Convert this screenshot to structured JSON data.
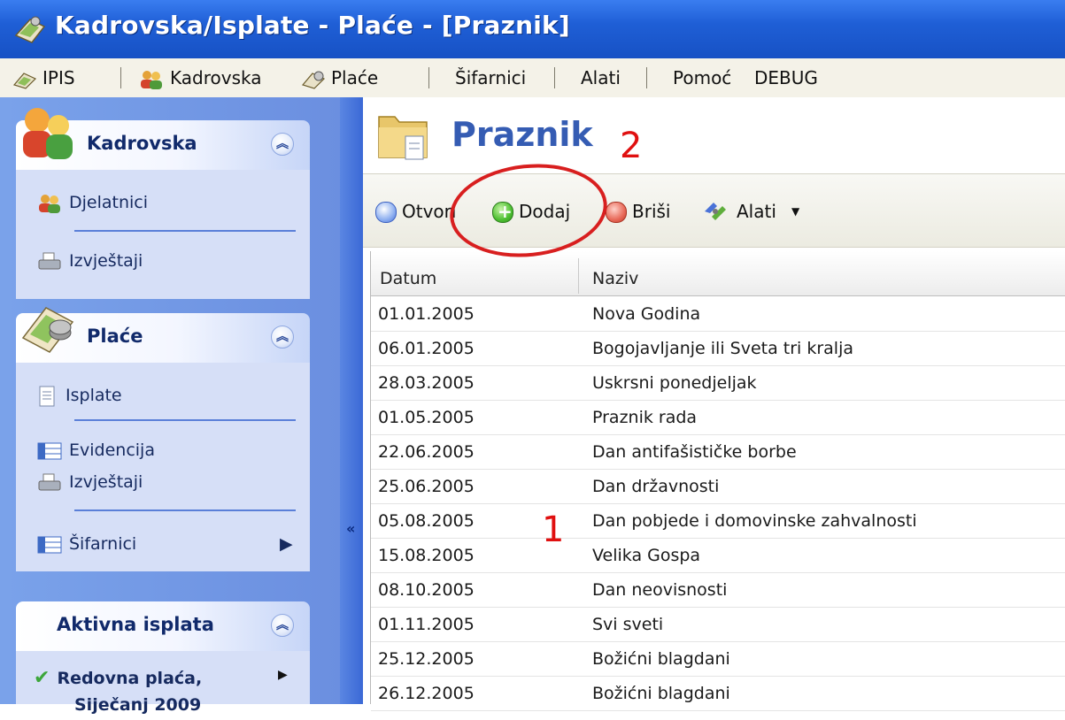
{
  "window": {
    "title": "Kadrovska/Isplate - Plaće - [Praznik]"
  },
  "menubar": {
    "items": [
      {
        "label": "IPIS",
        "icon": "app-icon"
      },
      {
        "label": "Kadrovska",
        "icon": "people-icon"
      },
      {
        "label": "Plaće",
        "icon": "payroll-icon"
      },
      {
        "label": "Šifarnici"
      },
      {
        "label": "Alati"
      },
      {
        "label": "Pomoć"
      },
      {
        "label": "DEBUG"
      }
    ]
  },
  "sidebar": {
    "kadrovska": {
      "title": "Kadrovska",
      "items": [
        {
          "label": "Djelatnici",
          "icon": "people-icon"
        },
        {
          "label": "Izvještaji",
          "icon": "printer-icon"
        }
      ]
    },
    "place": {
      "title": "Plaće",
      "items": [
        {
          "label": "Isplate",
          "icon": "document-icon"
        },
        {
          "label": "Evidencija",
          "icon": "grid-icon"
        },
        {
          "label": "Izvještaji",
          "icon": "printer-icon"
        },
        {
          "label": "Šifarnici",
          "icon": "grid-icon"
        }
      ]
    },
    "aktivna": {
      "title": "Aktivna isplata",
      "item_label": "Redovna plaća,",
      "item_label_2": "Siječanj 2009"
    }
  },
  "main": {
    "title": "Praznik",
    "annotation_1": "1",
    "annotation_2": "2",
    "toolbar": {
      "open": "Otvori",
      "add": "Dodaj",
      "delete": "Briši",
      "tools": "Alati"
    },
    "table": {
      "columns": [
        "Datum",
        "Naziv"
      ],
      "rows": [
        [
          "01.01.2005",
          "Nova Godina"
        ],
        [
          "06.01.2005",
          "Bogojavljanje ili Sveta tri kralja"
        ],
        [
          "28.03.2005",
          "Uskrsni ponedjeljak"
        ],
        [
          "01.05.2005",
          "Praznik rada"
        ],
        [
          "22.06.2005",
          "Dan antifašističke borbe"
        ],
        [
          "25.06.2005",
          "Dan državnosti"
        ],
        [
          "05.08.2005",
          "Dan pobjede i domovinske zahvalnosti"
        ],
        [
          "15.08.2005",
          "Velika Gospa"
        ],
        [
          "08.10.2005",
          "Dan neovisnosti"
        ],
        [
          "01.11.2005",
          "Svi sveti"
        ],
        [
          "25.12.2005",
          "Božićni blagdani"
        ],
        [
          "26.12.2005",
          "Božićni blagdani"
        ]
      ]
    }
  },
  "colors": {
    "titlebar": "#1f5fd6",
    "sidebar": "#7aa2ea",
    "title_text": "#355cb3",
    "annotation": "#e01010"
  }
}
